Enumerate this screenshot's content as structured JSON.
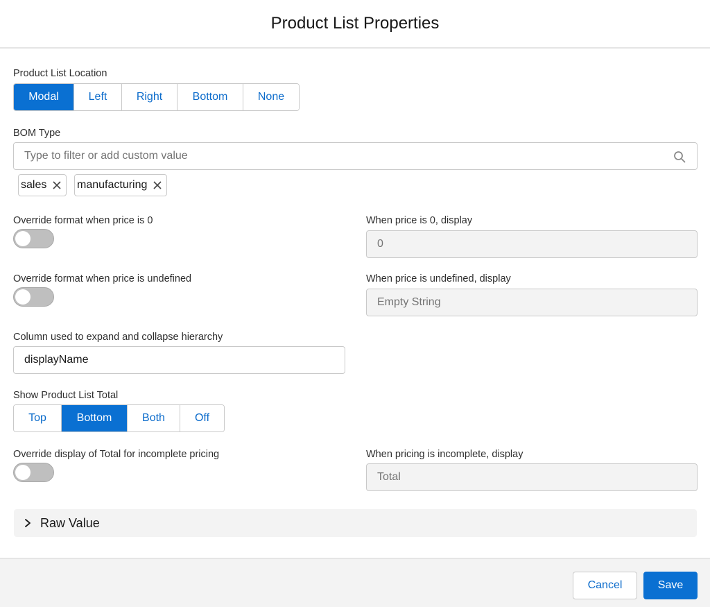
{
  "modal": {
    "title": "Product List Properties"
  },
  "location": {
    "label": "Product List Location",
    "options": [
      "Modal",
      "Left",
      "Right",
      "Bottom",
      "None"
    ],
    "selected": "Modal"
  },
  "bom": {
    "label": "BOM Type",
    "placeholder": "Type to filter or add custom value",
    "pills": [
      "sales",
      "manufacturing"
    ]
  },
  "price_zero": {
    "toggle_label": "Override format when price is 0",
    "toggle_on": false,
    "display_label": "When price is 0, display",
    "display_value": "0"
  },
  "price_undefined": {
    "toggle_label": "Override format when price is undefined",
    "toggle_on": false,
    "display_label": "When price is undefined, display",
    "display_value": "Empty String"
  },
  "hierarchy": {
    "label": "Column used to expand and collapse hierarchy",
    "value": "displayName"
  },
  "total": {
    "label": "Show Product List Total",
    "options": [
      "Top",
      "Bottom",
      "Both",
      "Off"
    ],
    "selected": "Bottom"
  },
  "incomplete": {
    "toggle_label": "Override display of Total for incomplete pricing",
    "toggle_on": false,
    "display_label": "When pricing is incomplete, display",
    "display_value": "Total"
  },
  "raw": {
    "label": "Raw Value"
  },
  "footer": {
    "cancel": "Cancel",
    "save": "Save"
  },
  "icons": {
    "search": "search-icon",
    "remove": "close-icon",
    "expand": "chevron-right-icon"
  },
  "colors": {
    "brand": "#0a70d2",
    "link": "#0b6bcb",
    "border": "#c9c9c9",
    "disabled_bg": "#f3f3f3"
  }
}
